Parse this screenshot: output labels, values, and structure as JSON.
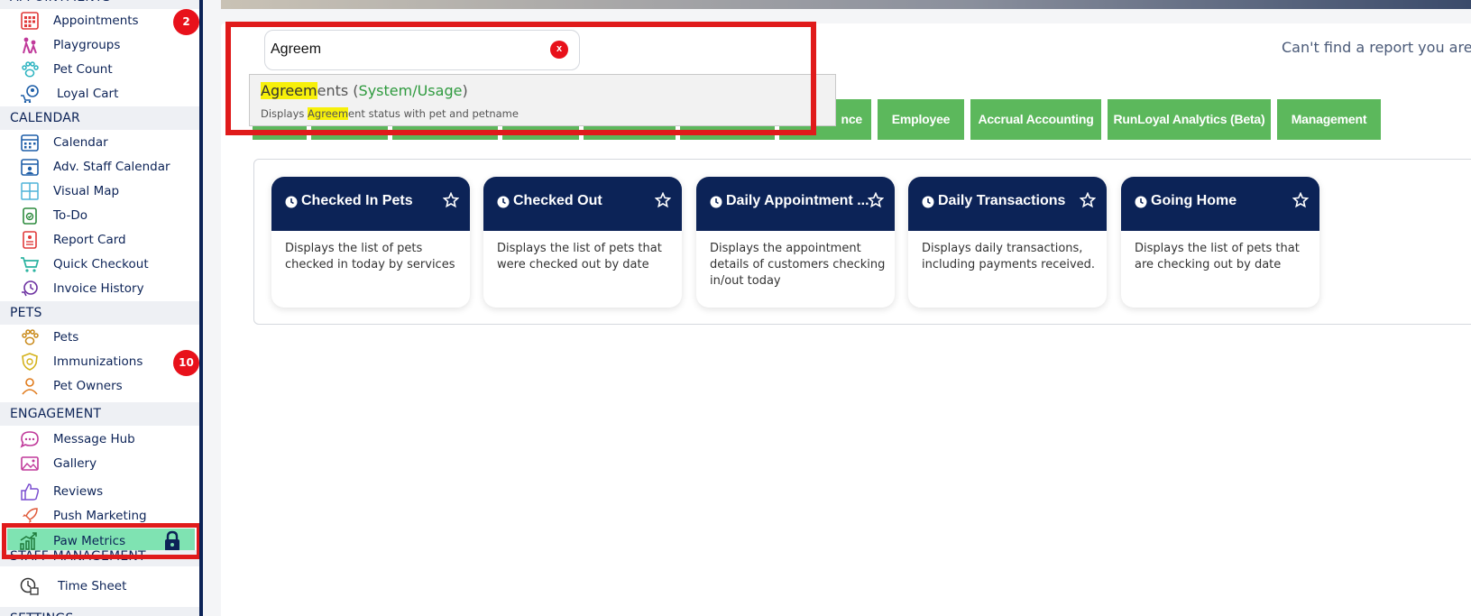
{
  "sidebar": {
    "sections": {
      "appointments_partial": "APPOINTMENTS",
      "calendar": "CALENDAR",
      "pets": "PETS",
      "engagement": "ENGAGEMENT",
      "staff_management": "STAFF MANAGEMENT",
      "settings_partial": "SETTINGS"
    },
    "items": {
      "appointments": {
        "label": "Appointments",
        "badge": "2",
        "icon": "appointments-grid-icon"
      },
      "playgroups": {
        "label": "Playgroups",
        "icon": "playgroups-icon"
      },
      "pet_count": {
        "label": "Pet Count",
        "icon": "paw-count-icon"
      },
      "loyal_cart": {
        "label": "Loyal Cart",
        "icon": "cart-person-icon"
      },
      "calendar": {
        "label": "Calendar",
        "icon": "calendar-icon"
      },
      "adv_staff_calendar": {
        "label": "Adv. Staff Calendar",
        "icon": "staff-calendar-icon"
      },
      "visual_map": {
        "label": "Visual Map",
        "icon": "map-grid-icon"
      },
      "todo": {
        "label": "To-Do",
        "icon": "todo-icon"
      },
      "report_card": {
        "label": "Report Card",
        "icon": "report-card-icon"
      },
      "quick_checkout": {
        "label": "Quick Checkout",
        "icon": "cart-icon"
      },
      "invoice_history": {
        "label": "Invoice History",
        "icon": "invoice-history-icon"
      },
      "pets": {
        "label": "Pets",
        "icon": "paw-icon"
      },
      "immunizations": {
        "label": "Immunizations",
        "badge": "10",
        "icon": "shield-icon"
      },
      "pet_owners": {
        "label": "Pet Owners",
        "icon": "person-icon"
      },
      "message_hub": {
        "label": "Message Hub",
        "icon": "chat-icon"
      },
      "gallery": {
        "label": "Gallery",
        "icon": "image-icon"
      },
      "reviews": {
        "label": "Reviews",
        "icon": "thumbs-up-icon"
      },
      "push_marketing": {
        "label": "Push Marketing",
        "icon": "rocket-icon"
      },
      "paw_metrics": {
        "label": "Paw Metrics",
        "icon": "chart-growth-icon"
      },
      "time_sheet": {
        "label": "Time Sheet",
        "icon": "clock-sheet-icon"
      }
    }
  },
  "search": {
    "value": "Agreem",
    "clear_label": "x",
    "help_text": "Can't find a report you are lo",
    "suggestion": {
      "match": "Agreem",
      "rest": "ents",
      "paren_open": " (",
      "category": "System/Usage",
      "paren_close": ")",
      "desc_before": "Displays ",
      "desc_match": "Agreem",
      "desc_after": "ent status with pet and petname"
    }
  },
  "tabs": [
    {
      "label": ""
    },
    {
      "label": ""
    },
    {
      "label": ""
    },
    {
      "label": ""
    },
    {
      "label": ""
    },
    {
      "label": ""
    },
    {
      "label": "nce"
    },
    {
      "label": "Employee"
    },
    {
      "label": "Accrual Accounting"
    },
    {
      "label": "RunLoyal Analytics (Beta)"
    },
    {
      "label": "Management"
    }
  ],
  "cards": [
    {
      "title": "Checked In Pets",
      "desc": "Displays the list of pets checked in today by services"
    },
    {
      "title": "Checked Out",
      "desc": "Displays the list of pets that were checked out by date"
    },
    {
      "title": "Daily Appointment ...",
      "desc": "Displays the appointment details of customers checking in/out today"
    },
    {
      "title": "Daily Transactions",
      "desc": "Displays daily transactions, including payments received."
    },
    {
      "title": "Going Home",
      "desc": "Displays the list of pets that are checking out by date"
    }
  ],
  "colors": {
    "navy": "#0c2357",
    "tab_green": "#5cb85c",
    "badge_red": "#e8111b",
    "highlight_red": "#e01b1b",
    "active_green": "#7fe3b2",
    "match_yellow": "#f7f00a"
  }
}
